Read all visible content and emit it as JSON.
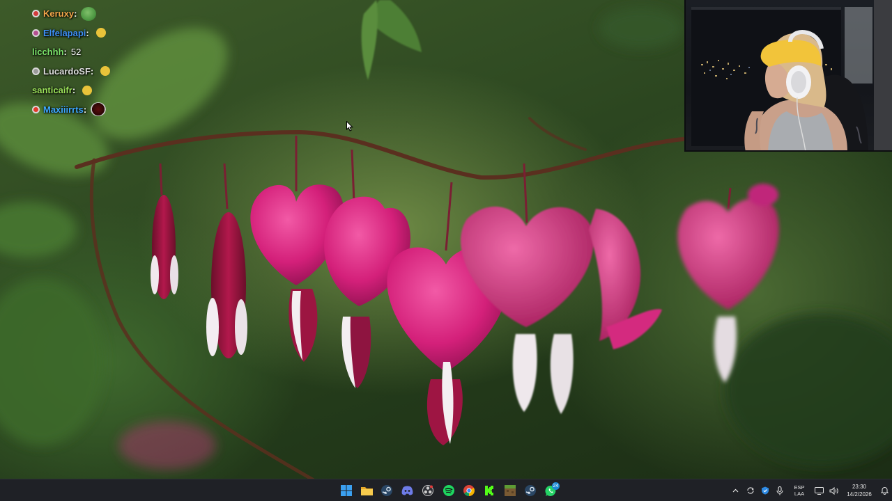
{
  "chat": {
    "messages": [
      {
        "user": "Keruxy",
        "text": "",
        "color": "#f4a64a",
        "badge": "#d23b3b",
        "emote": "pepe-emote"
      },
      {
        "user": "Elfelapapi",
        "text": "",
        "color": "#3d8ff5",
        "badge": "#b54f8f",
        "emote": "pointing-hand-emote"
      },
      {
        "user": "licchhh",
        "text": "52",
        "color": "#7be36a",
        "badge": "",
        "emote": ""
      },
      {
        "user": "LucardoSF",
        "text": "",
        "color": "#dcdcdc",
        "badge": "#9a9a9a",
        "emote": "pointing-hand-emote"
      },
      {
        "user": "santicaifr",
        "text": "",
        "color": "#9ce35a",
        "badge": "",
        "emote": "pointing-hand-emote"
      },
      {
        "user": "Maxiiirrts",
        "text": "",
        "color": "#3da8ff",
        "badge": "#e23a2a",
        "emote": "dark-orb-emote"
      }
    ]
  },
  "taskbar": {
    "apps": [
      {
        "name": "start-button",
        "icon": "windows-logo-icon"
      },
      {
        "name": "file-explorer",
        "icon": "folder-icon"
      },
      {
        "name": "steam",
        "icon": "steam-icon"
      },
      {
        "name": "discord",
        "icon": "discord-icon"
      },
      {
        "name": "obs",
        "icon": "obs-icon"
      },
      {
        "name": "spotify",
        "icon": "spotify-icon"
      },
      {
        "name": "chrome",
        "icon": "chrome-icon"
      },
      {
        "name": "kick",
        "icon": "kick-icon"
      },
      {
        "name": "minecraft",
        "icon": "minecraft-icon"
      },
      {
        "name": "steam-2",
        "icon": "steam-icon"
      },
      {
        "name": "whatsapp",
        "icon": "whatsapp-icon"
      }
    ],
    "whatsapp_badge": "24",
    "lang_line1": "ESP",
    "lang_line2": "LAA",
    "time": "23:30",
    "date": "14/2/2026"
  }
}
